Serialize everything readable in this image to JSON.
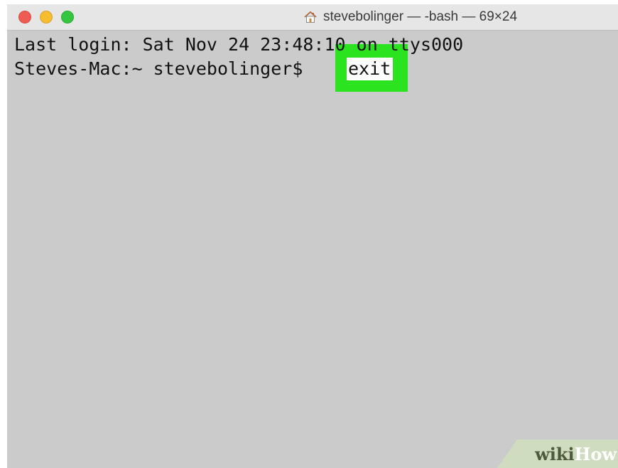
{
  "window": {
    "title": "stevebolinger — -bash — 69×24",
    "title_icon": "home-icon"
  },
  "terminal": {
    "line1": "Last login: Sat Nov 24 23:48:10 on ttys000",
    "prompt": "Steves-Mac:~ stevebolinger$ ",
    "command": "exit",
    "highlight_color": "#2be31f",
    "background_color": "#cbcbcb"
  },
  "watermark": {
    "wiki": "wiki",
    "how": "How"
  }
}
